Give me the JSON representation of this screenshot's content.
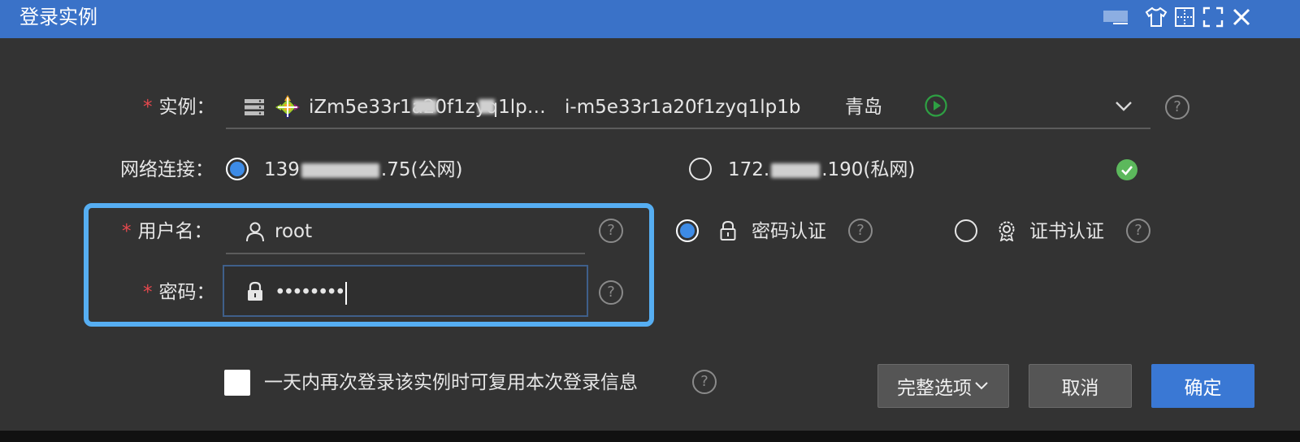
{
  "window": {
    "title": "登录实例",
    "controls": [
      "tshirt-icon",
      "layout-icon",
      "fullscreen-icon",
      "close-icon"
    ]
  },
  "instance": {
    "label": "实例：",
    "name": "iZm5e33r1a20f1zyq1lp…",
    "id": "i-m5e33r1a20f1zyq1lp1b",
    "region": "青岛",
    "status_color": "#2ea043"
  },
  "network": {
    "label": "网络连接：",
    "public": {
      "prefix": "139",
      "suffix": ".75(公网)",
      "selected": true
    },
    "private": {
      "prefix": "172.",
      "suffix": ".190(私网)",
      "selected": false
    },
    "check_color": "#5cb85c"
  },
  "username": {
    "label": "用户名：",
    "value": "root"
  },
  "password": {
    "label": "密码：",
    "masked": "••••••••"
  },
  "auth": {
    "password_auth": {
      "label": "密码认证",
      "selected": true
    },
    "cert_auth": {
      "label": "证书认证",
      "selected": false
    }
  },
  "remember": {
    "label": "一天内再次登录该实例时可复用本次登录信息",
    "checked": false
  },
  "buttons": {
    "options": "完整选项",
    "cancel": "取消",
    "confirm": "确定"
  },
  "required_mark": "*",
  "help_glyph": "?"
}
